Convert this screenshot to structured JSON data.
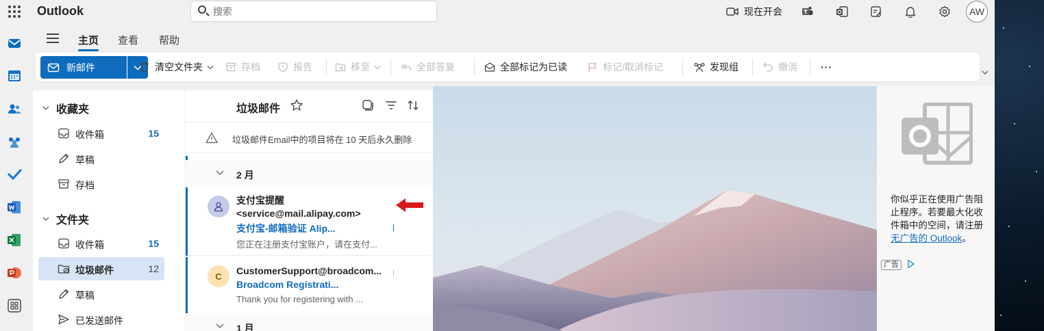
{
  "app": {
    "brand": "Outlook"
  },
  "search": {
    "placeholder": "搜索"
  },
  "topbar": {
    "meet_now": "现在开会",
    "avatar_initials": "AW"
  },
  "ribbon": {
    "tabs": [
      "主页",
      "查看",
      "帮助"
    ],
    "active_tab": "主页"
  },
  "commands": {
    "new_mail": "新邮件",
    "empty_folder": "清空文件夹",
    "archive": "存档",
    "report": "报告",
    "move_to": "移至",
    "reply_all": "全部答复",
    "mark_all_read": "全部标记为已读",
    "flag_unflag": "标记/取消标记",
    "discover_groups": "发现组",
    "undo": "撤消",
    "more": "···"
  },
  "folders": {
    "favorites_title": "收藏夹",
    "favorites": [
      {
        "label": "收件箱",
        "count": "15"
      },
      {
        "label": "草稿",
        "count": ""
      },
      {
        "label": "存档",
        "count": ""
      }
    ],
    "folders_title": "文件夹",
    "items": [
      {
        "label": "收件箱",
        "count": "15"
      },
      {
        "label": "垃圾邮件",
        "count": "12"
      },
      {
        "label": "草稿",
        "count": ""
      },
      {
        "label": "已发送邮件",
        "count": ""
      }
    ]
  },
  "message_list": {
    "title": "垃圾邮件",
    "notice": "垃圾邮件Email中的项目将在 10 天后永久删除",
    "groups": [
      "2 月",
      "1 月"
    ],
    "messages": [
      {
        "from_line1": "支付宝提醒",
        "from_line2": "<service@mail.alipay.com>",
        "subject": "支付宝-邮箱验证 Alip...",
        "preview": "您正在注册支付宝账户，请在支付...",
        "avatar_color": "#c5cbe9"
      },
      {
        "from_line1": "CustomerSupport@broadcom...",
        "subject": "Broadcom Registrati...",
        "preview": "Thank you for registering with ...",
        "avatar_initial": "C",
        "avatar_color": "#fbe2b0"
      }
    ]
  },
  "ad": {
    "text": "你似乎正在使用广告阻止程序。若要最大化收件箱中的空间，请注册 ",
    "link": "无广告的 Outlook",
    "period": "。",
    "badge": "广告"
  },
  "colors": {
    "accent": "#0f6cbd",
    "arrow": "#d71a1a"
  }
}
